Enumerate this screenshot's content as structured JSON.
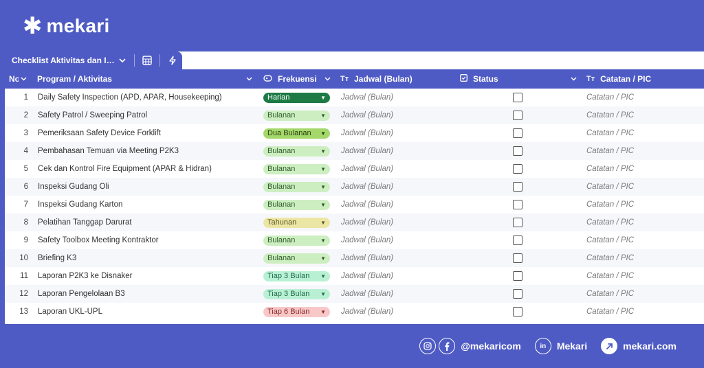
{
  "brand": {
    "logo_text": "mekari",
    "logo_glyph": "✱"
  },
  "tab": {
    "title": "Checklist Aktivitas dan In...",
    "chevron": "⌵"
  },
  "columns": {
    "no": "No",
    "program": "Program / Aktivitas",
    "frekuensi": "Frekuensi",
    "jadwal": "Jadwal (Bulan)",
    "status": "Status",
    "catatan": "Catatan / PIC"
  },
  "rows": [
    {
      "no": "1",
      "program": "Daily Safety Inspection (APD, APAR, Housekeeping)",
      "frekuensi": "Harian",
      "jadwal": "Jadwal (Bulan)",
      "catatan": "Catatan / PIC"
    },
    {
      "no": "2",
      "program": "Safety Patrol / Sweeping Patrol",
      "frekuensi": "Bulanan",
      "jadwal": "Jadwal (Bulan)",
      "catatan": "Catatan / PIC"
    },
    {
      "no": "3",
      "program": "Pemeriksaan Safety Device Forklift",
      "frekuensi": "Dua Bulanan",
      "jadwal": "Jadwal (Bulan)",
      "catatan": "Catatan / PIC"
    },
    {
      "no": "4",
      "program": "Pembahasan Temuan via Meeting P2K3",
      "frekuensi": "Bulanan",
      "jadwal": "Jadwal (Bulan)",
      "catatan": "Catatan / PIC"
    },
    {
      "no": "5",
      "program": "Cek dan Kontrol Fire Equipment (APAR & Hidran)",
      "frekuensi": "Bulanan",
      "jadwal": "Jadwal (Bulan)",
      "catatan": "Catatan / PIC"
    },
    {
      "no": "6",
      "program": "Inspeksi Gudang Oli",
      "frekuensi": "Bulanan",
      "jadwal": "Jadwal (Bulan)",
      "catatan": "Catatan / PIC"
    },
    {
      "no": "7",
      "program": "Inspeksi Gudang Karton",
      "frekuensi": "Bulanan",
      "jadwal": "Jadwal (Bulan)",
      "catatan": "Catatan / PIC"
    },
    {
      "no": "8",
      "program": "Pelatihan Tanggap Darurat",
      "frekuensi": "Tahunan",
      "jadwal": "Jadwal (Bulan)",
      "catatan": "Catatan / PIC"
    },
    {
      "no": "9",
      "program": "Safety Toolbox Meeting Kontraktor",
      "frekuensi": "Bulanan",
      "jadwal": "Jadwal (Bulan)",
      "catatan": "Catatan / PIC"
    },
    {
      "no": "10",
      "program": "Briefing K3",
      "frekuensi": "Bulanan",
      "jadwal": "Jadwal (Bulan)",
      "catatan": "Catatan / PIC"
    },
    {
      "no": "11",
      "program": "Laporan P2K3 ke Disnaker",
      "frekuensi": "Tiap 3 Bulan",
      "jadwal": "Jadwal (Bulan)",
      "catatan": "Catatan / PIC"
    },
    {
      "no": "12",
      "program": "Laporan Pengelolaan B3",
      "frekuensi": "Tiap 3 Bulan",
      "jadwal": "Jadwal (Bulan)",
      "catatan": "Catatan / PIC"
    },
    {
      "no": "13",
      "program": "Laporan UKL-UPL",
      "frekuensi": "Tiap 6 Bulan",
      "jadwal": "Jadwal (Bulan)",
      "catatan": "Catatan / PIC"
    }
  ],
  "frequency_styles": {
    "Harian": {
      "bg": "#1e7a45",
      "fg": "#ffffff"
    },
    "Bulanan": {
      "bg": "#cdeec0",
      "fg": "#2e5b2a"
    },
    "Dua Bulanan": {
      "bg": "#a4d86a",
      "fg": "#2a3f12"
    },
    "Tahunan": {
      "bg": "#ece6a5",
      "fg": "#5a5320"
    },
    "Tiap 3 Bulan": {
      "bg": "#b9f0d4",
      "fg": "#1f6d4b"
    },
    "Tiap 6 Bulan": {
      "bg": "#f8c8c8",
      "fg": "#8a2a2a"
    }
  },
  "footer": {
    "social_handle": "@mekaricom",
    "linkedin_label": "Mekari",
    "website": "mekari.com"
  },
  "colors": {
    "brand": "#4f5bc4",
    "header": "#4f5bc4",
    "row_alt": "#f6f7fb"
  }
}
